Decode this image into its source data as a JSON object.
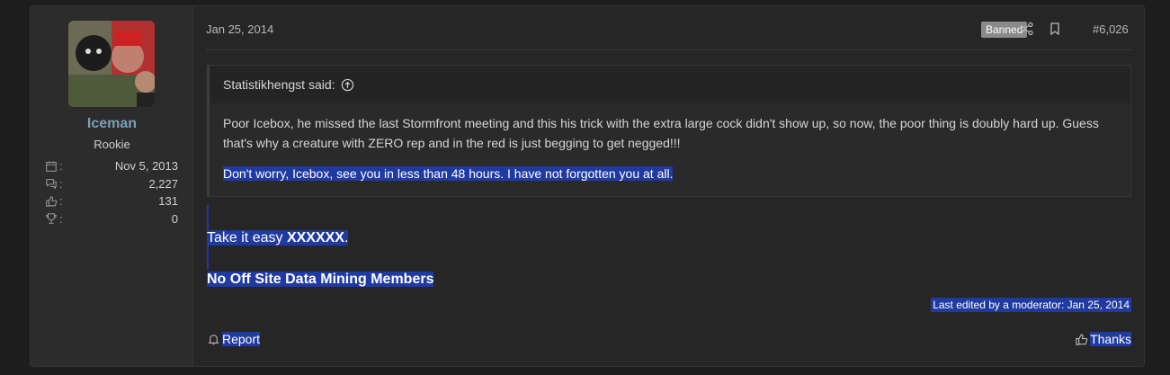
{
  "user": {
    "name": "Iceman",
    "title": "Rookie",
    "stats": [
      {
        "icon": "calendar-icon",
        "value": "Nov 5, 2013"
      },
      {
        "icon": "messages-icon",
        "value": "2,227"
      },
      {
        "icon": "like-icon",
        "value": "131"
      },
      {
        "icon": "trophy-icon",
        "value": "0"
      }
    ]
  },
  "post": {
    "date": "Jan 25, 2014",
    "badge": "Banned",
    "number": "#6,026",
    "quote": {
      "author": "Statistikhengst said:",
      "line1": "Poor Icebox, he missed the last Stormfront meeting and this his trick with the extra large cock didn't show up, so now, the poor thing is doubly hard up. Guess that's why a creature with ZERO rep and in the red is just begging to get negged!!!",
      "line2": "Don't worry, Icebox, see you in less than 48 hours. I have not forgotten you at all."
    },
    "body_prefix": "Take it easy ",
    "body_bold": "XXXXXX",
    "body_suffix": ".",
    "body2": "No Off Site Data Mining Members",
    "edited": "Last edited by a moderator: Jan 25, 2014",
    "report_label": "Report",
    "thanks_label": "Thanks"
  },
  "colors": {
    "accent_username": "#7aa0b6",
    "selection": "#1f3aa0",
    "badge_bg": "#8a8a8a"
  }
}
